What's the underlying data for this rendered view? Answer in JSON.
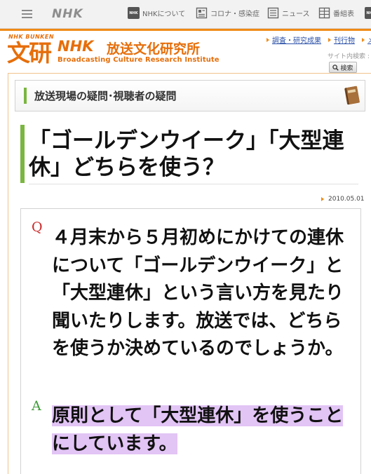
{
  "global_nav": {
    "logo": "NHK",
    "items": [
      {
        "label": "NHKについて",
        "icon": "nhk-badge-icon"
      },
      {
        "label": "コロナ・感染症",
        "icon": "news-document-icon"
      },
      {
        "label": "ニュース",
        "icon": "newspaper-icon"
      },
      {
        "label": "番組表",
        "icon": "schedule-grid-icon"
      }
    ],
    "cut_off_badge": "NHK"
  },
  "institute": {
    "bunken_small": "NHK BUNKEN",
    "bunken_kanji": "文研",
    "nhk": "NHK",
    "name": "放送文化研究所",
    "english": "Broadcasting Culture Research Institute",
    "links": [
      "調査・研究成果",
      "刊行物",
      "メ"
    ],
    "site_search_label": "サイト内検索 :",
    "search_button": "検索"
  },
  "section": {
    "title": "放送現場の疑問･視聴者の疑問"
  },
  "article": {
    "title": "「ゴールデンウイーク」「大型連休」どちらを使う？",
    "date": "2010.05.01",
    "q_mark": "Q",
    "question": "４月末から５月初めにかけての連休について「ゴールデンウイーク」と 「大型連休」という言い方を見たり聞いたりします。放送では、どちらを使うか決めているのでしょうか。",
    "a_mark": "A",
    "answer": "原則として「大型連休」を使うことにしています。"
  },
  "colors": {
    "brand_orange": "#e66e0a",
    "accent_green": "#7ab640",
    "answer_highlight": "#e2c4f5",
    "link_blue": "#2a50a8"
  }
}
